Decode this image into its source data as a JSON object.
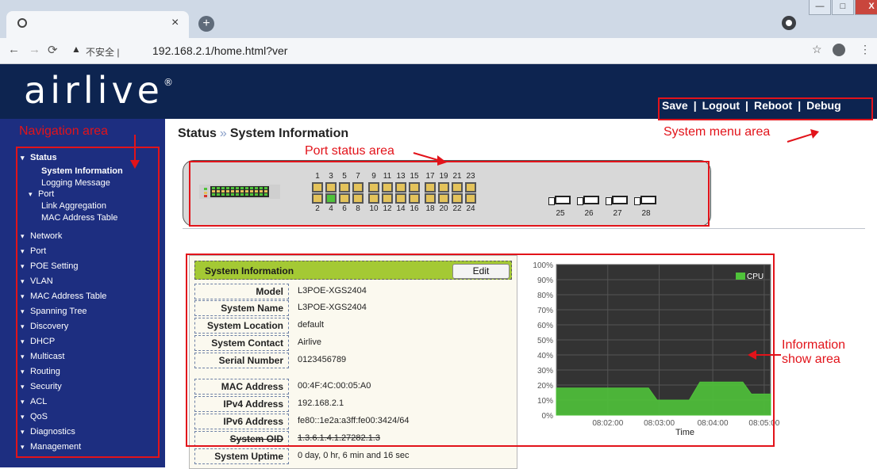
{
  "browser": {
    "url_warning": "不安全",
    "url": "192.168.2.1/home.html?ver",
    "window_buttons": [
      "—",
      "□",
      "X"
    ]
  },
  "app": {
    "logo_text": "airlive",
    "logo_mark": "®",
    "system_menu": [
      "Save",
      "Logout",
      "Reboot",
      "Debug"
    ]
  },
  "sidebar": {
    "items": [
      {
        "label": "Status",
        "expanded": true
      },
      {
        "label": "System Information"
      },
      {
        "label": "Logging Message"
      },
      {
        "label": "Port"
      },
      {
        "label": "Link Aggregation"
      },
      {
        "label": "MAC Address Table"
      },
      {
        "label": "Network"
      },
      {
        "label": "Port"
      },
      {
        "label": "POE Setting"
      },
      {
        "label": "VLAN"
      },
      {
        "label": "MAC Address Table"
      },
      {
        "label": "Spanning Tree"
      },
      {
        "label": "Discovery"
      },
      {
        "label": "DHCP"
      },
      {
        "label": "Multicast"
      },
      {
        "label": "Routing"
      },
      {
        "label": "Security"
      },
      {
        "label": "ACL"
      },
      {
        "label": "QoS"
      },
      {
        "label": "Diagnostics"
      },
      {
        "label": "Management"
      }
    ]
  },
  "breadcrumb": {
    "section": "Status",
    "separator": "»",
    "page": "System Information"
  },
  "ports": {
    "top_labels": [
      "1",
      "3",
      "5",
      "7",
      "9",
      "11",
      "13",
      "15",
      "17",
      "19",
      "21",
      "23"
    ],
    "bottom_labels": [
      "2",
      "4",
      "6",
      "8",
      "10",
      "12",
      "14",
      "16",
      "18",
      "20",
      "22",
      "24"
    ],
    "sfp_labels": [
      "25",
      "26",
      "27",
      "28"
    ],
    "green_port": "4"
  },
  "info": {
    "title": "System Information",
    "edit_label": "Edit",
    "rows": [
      {
        "k": "Model",
        "v": "L3POE-XGS2404"
      },
      {
        "k": "System Name",
        "v": "L3POE-XGS2404"
      },
      {
        "k": "System Location",
        "v": "default"
      },
      {
        "k": "System Contact",
        "v": "Airlive"
      },
      {
        "k": "Serial Number",
        "v": "0123456789"
      },
      {
        "k": "MAC Address",
        "v": "00:4F:4C:00:05:A0"
      },
      {
        "k": "IPv4 Address",
        "v": "192.168.2.1"
      },
      {
        "k": "IPv6 Address",
        "v": "fe80::1e2a:a3ff:fe00:3424/64"
      },
      {
        "k": "System OID",
        "v": "1.3.6.1.4.1.27282.1.3"
      },
      {
        "k": "System Uptime",
        "v": "0 day, 0 hr, 6 min and 16 sec"
      }
    ]
  },
  "annotations": {
    "navigation": "Navigation area",
    "system_menu": "System menu area",
    "port_status": "Port status area",
    "info_show_line1": "Information",
    "info_show_line2": "show area"
  },
  "colors": {
    "header_bg": "#0d2450",
    "sidebar_bg": "#1d2e80",
    "info_header": "#a4c934",
    "chart_bg": "#333333",
    "cpu_area": "#4fc23a",
    "annotation": "#e2131a"
  },
  "chart_data": {
    "type": "area",
    "ylabel": "",
    "xlabel": "Time",
    "yticks": [
      "0%",
      "10%",
      "20%",
      "30%",
      "40%",
      "50%",
      "60%",
      "70%",
      "80%",
      "90%",
      "100%"
    ],
    "ylim": [
      0,
      100
    ],
    "xticks": [
      "08:02:00",
      "08:03:00",
      "08:04:00",
      "08:05:00"
    ],
    "legend": "top-right",
    "grid": true,
    "series": [
      {
        "name": "CPU",
        "color": "#4fc23a",
        "x": [
          0,
          27,
          43,
          47,
          62,
          67,
          87,
          91,
          100
        ],
        "y": [
          18,
          18,
          18,
          10,
          10,
          22,
          22,
          14,
          14
        ]
      }
    ]
  }
}
